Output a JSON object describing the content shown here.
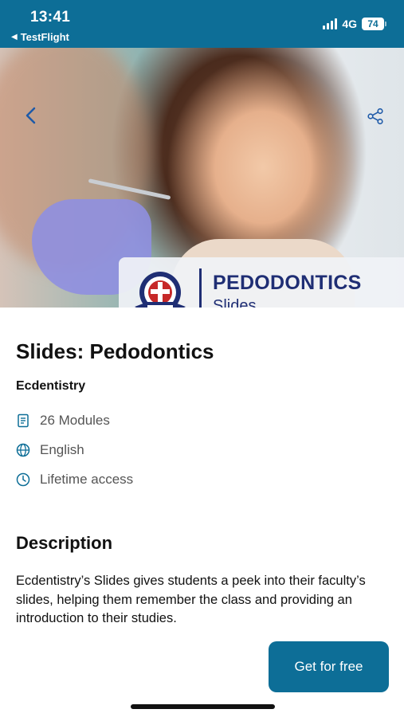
{
  "status_bar": {
    "time": "13:41",
    "back_app": "TestFlight",
    "network": "4G",
    "battery": "74"
  },
  "hero": {
    "badge_title": "PEDODONTICS",
    "badge_subtitle": "Slides",
    "icons": {
      "back": "chevron-left-icon",
      "share": "share-icon"
    }
  },
  "course": {
    "title": "Slides: Pedodontics",
    "author": "Ecdentistry",
    "meta": [
      {
        "icon": "document-icon",
        "text": "26 Modules"
      },
      {
        "icon": "globe-icon",
        "text": "English"
      },
      {
        "icon": "clock-icon",
        "text": "Lifetime access"
      }
    ]
  },
  "description": {
    "heading": "Description",
    "text": "Ecdentistry’s Slides gives students a peek into their faculty’s slides, helping them remember the class and providing an introduction to their studies."
  },
  "cta": {
    "label": "Get for free"
  },
  "colors": {
    "primary": "#0d6e97",
    "badge_text": "#1f2e74"
  }
}
